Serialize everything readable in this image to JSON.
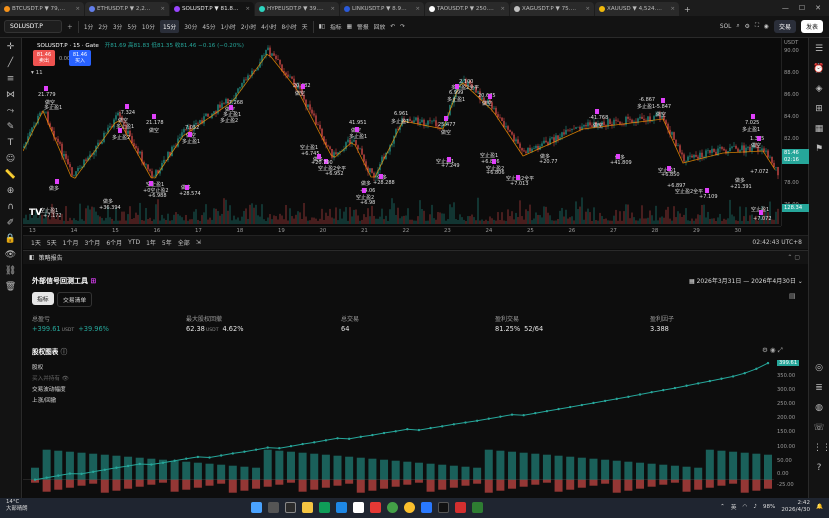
{
  "browser": {
    "tabs": [
      {
        "label": "BTCUSDT.P ▼ 79,…",
        "active": false,
        "color": "#f7931a"
      },
      {
        "label": "ETHUSDT.P ▼ 2,2…",
        "active": false,
        "color": "#627eea"
      },
      {
        "label": "SOLUSDT.P ▼ 81.8…",
        "active": true,
        "color": "#9945ff"
      },
      {
        "label": "HYPEUSDT.P ▼ 39.…",
        "active": false,
        "color": "#2dd4bf"
      },
      {
        "label": "LINKUSDT.P ▼ 8.9…",
        "active": false,
        "color": "#2a5ada"
      },
      {
        "label": "TAOUSDT.P ▼ 250.…",
        "active": false,
        "color": "#ffffff"
      },
      {
        "label": "XAGUSDT.P ▼ 75.…",
        "active": false,
        "color": "#c0c0c0"
      },
      {
        "label": "XAUUSD ▼ 4,524.…",
        "active": false,
        "color": "#f0b90b"
      }
    ],
    "window_controls": [
      "—",
      "☐",
      "✕"
    ]
  },
  "toolbar": {
    "symbol": "SOLUSDT.P",
    "intervals": [
      "1分",
      "2分",
      "3分",
      "5分",
      "10分",
      "15分",
      "30分",
      "45分",
      "1小时",
      "2小时",
      "4小时",
      "8小时",
      "天"
    ],
    "active_interval": "15分",
    "indicators_label": "指标",
    "alert_label": "警报",
    "replay_label": "回放",
    "layout_label": "SOL",
    "trade_label": "交易",
    "publish_label": "发表"
  },
  "chart": {
    "title": "SOLUSDT.P · 15 · Gate",
    "ohlc": "开81.69 高81.83 低81.35 收81.46 −0.16 (−0.20%)",
    "bid_price": "81.46",
    "bid_label": "卖出",
    "spread": "0.00",
    "ask_price": "81.46",
    "ask_label": "买入",
    "volume_label": "11",
    "price_axis": [
      "90.00",
      "88.00",
      "86.00",
      "84.00",
      "82.00",
      "80.00",
      "78.00",
      "76.00"
    ],
    "price_axis_unit": "USDT",
    "current_price": "81.46",
    "countdown": "02:16",
    "volume_tag": "128.34",
    "date_axis": [
      "13",
      "14",
      "15",
      "16",
      "17",
      "18",
      "19",
      "20",
      "21",
      "22",
      "23",
      "24",
      "25",
      "26",
      "27",
      "28",
      "29",
      "30"
    ],
    "signals": [
      {
        "text": "21.779",
        "x": 15,
        "y": 54
      },
      {
        "text": "做空",
        "x": 22,
        "y": 61
      },
      {
        "text": "多止盈1",
        "x": 21,
        "y": 66
      },
      {
        "text": "做多",
        "x": 26,
        "y": 147
      },
      {
        "text": "空止盈1",
        "x": 17,
        "y": 169
      },
      {
        "text": "+7.172",
        "x": 20,
        "y": 175
      },
      {
        "text": "-7.324",
        "x": 96,
        "y": 72
      },
      {
        "text": "做空",
        "x": 95,
        "y": 79
      },
      {
        "text": "多止盈1",
        "x": 93,
        "y": 85
      },
      {
        "text": "多止盈2",
        "x": 89,
        "y": 96
      },
      {
        "text": "做多",
        "x": 80,
        "y": 160
      },
      {
        "text": "+36.394",
        "x": 76,
        "y": 167
      },
      {
        "text": "21.178",
        "x": 123,
        "y": 82
      },
      {
        "text": "做空",
        "x": 126,
        "y": 89
      },
      {
        "text": "空止盈1",
        "x": 123,
        "y": 143
      },
      {
        "text": "+0空止盈2",
        "x": 120,
        "y": 149
      },
      {
        "text": "+6.988",
        "x": 125,
        "y": 155
      },
      {
        "text": "做多",
        "x": 158,
        "y": 146
      },
      {
        "text": "+28.574",
        "x": 156,
        "y": 153
      },
      {
        "text": "7.052",
        "x": 162,
        "y": 87
      },
      {
        "text": "做空",
        "x": 163,
        "y": 94
      },
      {
        "text": "多止盈1",
        "x": 159,
        "y": 100
      },
      {
        "text": "-7.268",
        "x": 204,
        "y": 62
      },
      {
        "text": "做空",
        "x": 202,
        "y": 68
      },
      {
        "text": "多止盈1",
        "x": 200,
        "y": 73
      },
      {
        "text": "多止盈2",
        "x": 197,
        "y": 79
      },
      {
        "text": "20.482",
        "x": 270,
        "y": 45
      },
      {
        "text": "做空",
        "x": 272,
        "y": 52
      },
      {
        "text": "空止盈1",
        "x": 277,
        "y": 106
      },
      {
        "text": "+6.745",
        "x": 278,
        "y": 113
      },
      {
        "text": "空止盈2全平",
        "x": 295,
        "y": 127
      },
      {
        "text": "+6.952",
        "x": 302,
        "y": 133
      },
      {
        "text": "做多",
        "x": 290,
        "y": 118
      },
      {
        "text": "+20.790",
        "x": 288,
        "y": 122
      },
      {
        "text": "41.951",
        "x": 326,
        "y": 82
      },
      {
        "text": "做空",
        "x": 328,
        "y": 89
      },
      {
        "text": "多止盈1",
        "x": 326,
        "y": 95
      },
      {
        "text": "做多",
        "x": 338,
        "y": 142
      },
      {
        "text": "+4.06",
        "x": 337,
        "y": 150
      },
      {
        "text": "空止盈2",
        "x": 333,
        "y": 156
      },
      {
        "text": "+6.98",
        "x": 337,
        "y": 162
      },
      {
        "text": "做多",
        "x": 354,
        "y": 136
      },
      {
        "text": "+28.288",
        "x": 350,
        "y": 142
      },
      {
        "text": "6.961",
        "x": 371,
        "y": 73
      },
      {
        "text": "多止盈1",
        "x": 368,
        "y": 80
      },
      {
        "text": "25.477",
        "x": 415,
        "y": 84
      },
      {
        "text": "做空",
        "x": 418,
        "y": 91
      },
      {
        "text": "空止盈1",
        "x": 413,
        "y": 120
      },
      {
        "text": "+7.249",
        "x": 418,
        "y": 125
      },
      {
        "text": "2.100",
        "x": 436,
        "y": 41
      },
      {
        "text": "多止盈2全平",
        "x": 428,
        "y": 46
      },
      {
        "text": "6.999",
        "x": 426,
        "y": 52
      },
      {
        "text": "多止盈1",
        "x": 424,
        "y": 58
      },
      {
        "text": "20.675",
        "x": 455,
        "y": 55
      },
      {
        "text": "做空",
        "x": 459,
        "y": 62
      },
      {
        "text": "空止盈1",
        "x": 457,
        "y": 114
      },
      {
        "text": "+6.806",
        "x": 458,
        "y": 121
      },
      {
        "text": "空止盈2",
        "x": 463,
        "y": 127
      },
      {
        "text": "+6.806",
        "x": 463,
        "y": 132
      },
      {
        "text": "空止盈2全平",
        "x": 483,
        "y": 137
      },
      {
        "text": "+7.013",
        "x": 487,
        "y": 143
      },
      {
        "text": "做多",
        "x": 517,
        "y": 115
      },
      {
        "text": "+20.77",
        "x": 516,
        "y": 121
      },
      {
        "text": "-41.768",
        "x": 566,
        "y": 77
      },
      {
        "text": "做空",
        "x": 570,
        "y": 84
      },
      {
        "text": "做多",
        "x": 592,
        "y": 116
      },
      {
        "text": "+41.809",
        "x": 587,
        "y": 122
      },
      {
        "text": "-6.867",
        "x": 616,
        "y": 59
      },
      {
        "text": "多止盈1",
        "x": 614,
        "y": 65
      },
      {
        "text": "-5.847",
        "x": 632,
        "y": 66
      },
      {
        "text": "做空",
        "x": 633,
        "y": 73
      },
      {
        "text": "空止盈1",
        "x": 635,
        "y": 129
      },
      {
        "text": "+6.850",
        "x": 638,
        "y": 134
      },
      {
        "text": "+6.897",
        "x": 644,
        "y": 145
      },
      {
        "text": "空止盈2全平",
        "x": 652,
        "y": 150
      },
      {
        "text": "+7.109",
        "x": 676,
        "y": 156
      },
      {
        "text": "做多",
        "x": 712,
        "y": 139
      },
      {
        "text": "+21.391",
        "x": 707,
        "y": 146
      },
      {
        "text": "7.025",
        "x": 722,
        "y": 82
      },
      {
        "text": "多止盈1",
        "x": 719,
        "y": 88
      },
      {
        "text": "1.305",
        "x": 727,
        "y": 98
      },
      {
        "text": "做空",
        "x": 728,
        "y": 104
      },
      {
        "text": "+7.072",
        "x": 727,
        "y": 131
      },
      {
        "text": "空止盈1",
        "x": 728,
        "y": 168
      },
      {
        "text": "+7.072",
        "x": 730,
        "y": 178
      },
      {
        "text": "空止盈2全平",
        "x": 726,
        "y": 200
      },
      {
        "text": "+7.189",
        "x": 731,
        "y": 207
      }
    ]
  },
  "range_bar": {
    "ranges": [
      "1天",
      "5天",
      "1个月",
      "3个月",
      "6个月",
      "YTD",
      "1年",
      "5年",
      "全部"
    ],
    "clock": "02:42:43 UTC+8"
  },
  "panel": {
    "header_title": "策略报告",
    "strategy_name": "外部信号回测工具",
    "date_range": "2026年3月31日 — 2026年4月30日",
    "tabs": [
      "指标",
      "交易清单"
    ],
    "active_tab": "指标",
    "metrics": [
      {
        "label": "总盈亏",
        "value": "+399.61",
        "unit": "USDT",
        "extra": "+39.96%"
      },
      {
        "label": "最大股权回撤",
        "value": "62.38",
        "unit": "USDT",
        "extra": "4.62%"
      },
      {
        "label": "总交易",
        "value": "64",
        "unit": "",
        "extra": ""
      },
      {
        "label": "盈利交易",
        "value": "81.25%",
        "unit": "",
        "extra": "52/64"
      },
      {
        "label": "盈利因子",
        "value": "3.388",
        "unit": "",
        "extra": ""
      }
    ],
    "equity_title": "股权图表",
    "equity_legend": [
      "股权",
      "买入并持有",
      "交易波动幅度",
      "上涨/回撤"
    ],
    "equity_axis": [
      "399.61",
      "350.00",
      "300.00",
      "250.00",
      "200.00",
      "150.00",
      "100.00",
      "50.00",
      "0.00",
      "-25.00"
    ],
    "equity_tag": "399.61"
  },
  "chart_data": {
    "type": "line",
    "title": "股权图表",
    "x": [
      1,
      2,
      3,
      4,
      5,
      6,
      7,
      8,
      9,
      10,
      11,
      12,
      13,
      14,
      15,
      16,
      17,
      18,
      19,
      20,
      21,
      22,
      23,
      24,
      25,
      26,
      27,
      28,
      29,
      30,
      31,
      32,
      33,
      34,
      35,
      36,
      37,
      38,
      39,
      40,
      41,
      42,
      43,
      44,
      45,
      46,
      47,
      48,
      49,
      50,
      51,
      52,
      53,
      54,
      55,
      56,
      57,
      58,
      59,
      60,
      61,
      62,
      63,
      64
    ],
    "series": [
      {
        "name": "股权",
        "values": [
          0,
          7,
          14,
          21,
          20,
          27,
          34,
          41,
          47,
          54,
          52,
          58,
          65,
          72,
          78,
          76,
          83,
          90,
          96,
          103,
          110,
          108,
          115,
          122,
          128,
          135,
          142,
          140,
          147,
          153,
          160,
          166,
          173,
          170,
          177,
          183,
          190,
          196,
          202,
          209,
          216,
          223,
          221,
          228,
          235,
          242,
          249,
          256,
          263,
          270,
          277,
          284,
          292,
          300,
          307,
          314,
          322,
          330,
          338,
          346,
          354,
          365,
          380,
          399.61
        ]
      }
    ],
    "ylim": [
      -25,
      400
    ]
  },
  "taskbar": {
    "weather_temp": "14°C",
    "weather_desc": "大部晴朗",
    "lang": "英",
    "battery": "98%",
    "time": "2:42",
    "date": "2026/4/30"
  },
  "colors": {
    "up": "#26a69a",
    "down": "#ef5350",
    "signal": "#e040fb",
    "accent": "#2962ff"
  }
}
